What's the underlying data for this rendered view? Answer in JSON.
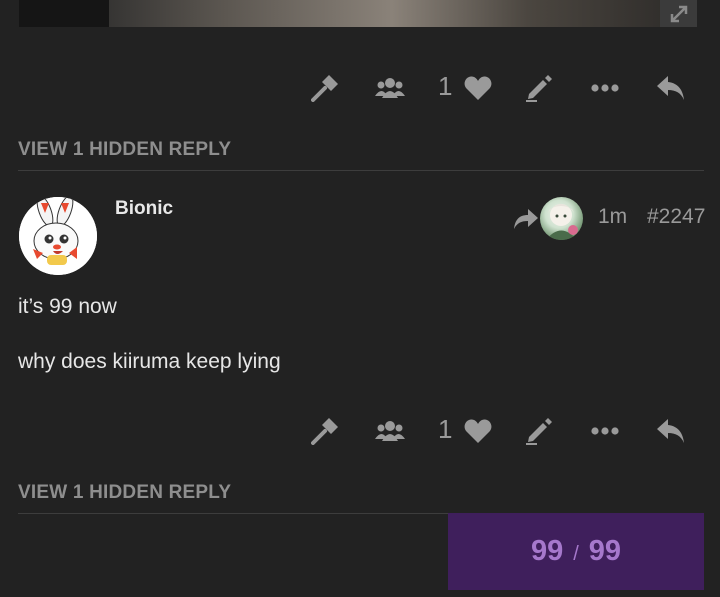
{
  "top_post": {
    "actions": {
      "like_count": "1"
    },
    "hidden_reply": "VIEW 1 HIDDEN REPLY"
  },
  "post": {
    "username": "Bionic",
    "age": "1m",
    "post_number": "#2247",
    "body": [
      "it’s 99 now",
      "why does kiiruma keep lying"
    ],
    "actions": {
      "like_count": "1"
    },
    "hidden_reply": "VIEW 1 HIDDEN REPLY"
  },
  "progress": {
    "current": "99",
    "separator": "/",
    "total": "99"
  },
  "icons": [
    "expand-icon",
    "admin-wrench-icon",
    "group-icon",
    "heart-icon",
    "edit-pencil-icon",
    "more-ellipsis-icon",
    "reply-arrow-icon",
    "share-reply-arrow-icon"
  ],
  "colors": {
    "background": "#222222",
    "text": "#e6e6e6",
    "muted": "#9a9a9a",
    "progress_bg": "#3f1f5c",
    "progress_text": "#a678cc"
  }
}
